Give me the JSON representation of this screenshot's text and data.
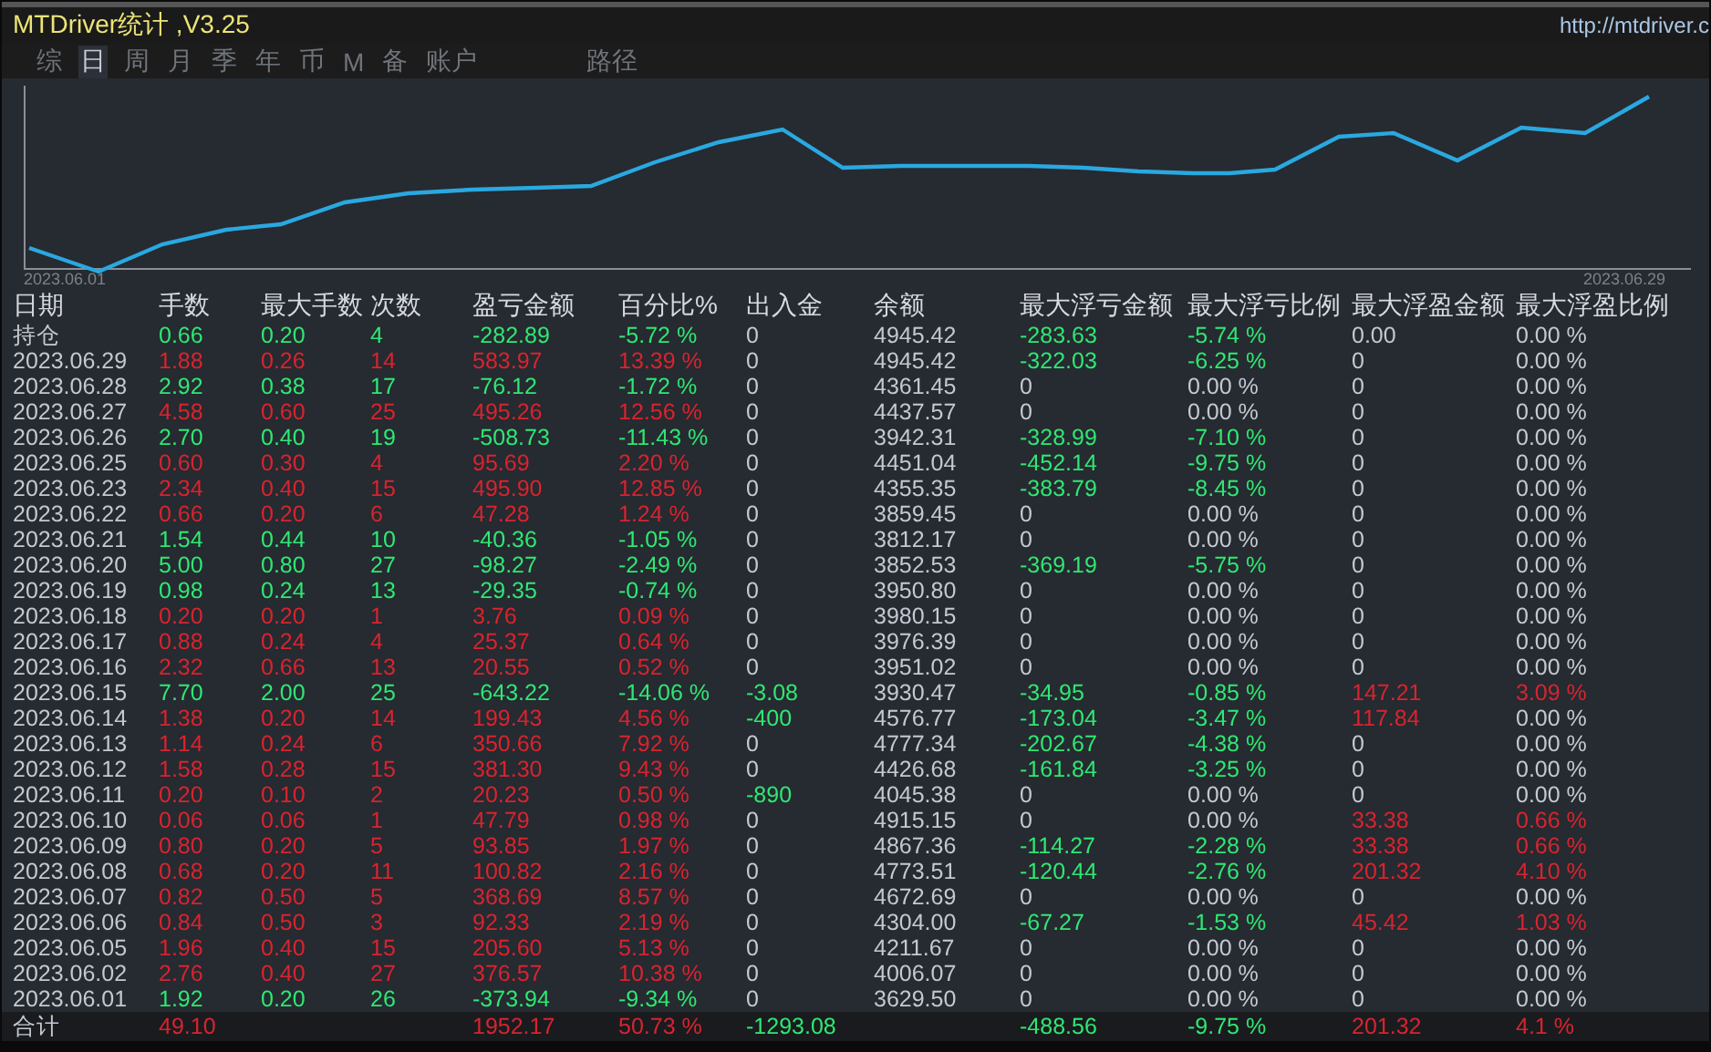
{
  "window": {
    "title": "MTDriver统计 ,V3.25",
    "url": "http://mtdriver.c"
  },
  "tabs": [
    {
      "label": "综",
      "selected": false
    },
    {
      "label": "日",
      "selected": true
    },
    {
      "label": "周",
      "selected": false
    },
    {
      "label": "月",
      "selected": false
    },
    {
      "label": "季",
      "selected": false
    },
    {
      "label": "年",
      "selected": false
    },
    {
      "label": "币",
      "selected": false
    },
    {
      "label": "M",
      "selected": false
    },
    {
      "label": "备",
      "selected": false
    },
    {
      "label": "账户",
      "selected": false
    },
    {
      "label": "路径",
      "selected": false
    }
  ],
  "equity_chart": {
    "start_label": "2023.06.01",
    "end_label": "2023.06.29"
  },
  "table": {
    "columns": [
      "日期",
      "手数",
      "最大手数",
      "次数",
      "盈亏金额",
      "百分比%",
      "出入金",
      "余额",
      "最大浮亏金额",
      "最大浮亏比例",
      "最大浮盈金额",
      "最大浮盈比例"
    ],
    "rows": [
      {
        "cells": [
          {
            "text": "持仓"
          },
          {
            "text": "0.66",
            "color": "#2ee872"
          },
          {
            "text": "0.20",
            "color": "#2ee872"
          },
          {
            "text": "4",
            "color": "#2ee872"
          },
          {
            "text": "-282.89",
            "color": "#2ee872"
          },
          {
            "text": "-5.72 %",
            "color": "#2ee872"
          },
          {
            "text": "0"
          },
          {
            "text": "4945.42"
          },
          {
            "text": "-283.63",
            "color": "#2ee872"
          },
          {
            "text": "-5.74 %",
            "color": "#2ee872"
          },
          {
            "text": "0.00"
          },
          {
            "text": "0.00 %"
          }
        ]
      },
      {
        "cells": [
          {
            "text": "2023.06.29"
          },
          {
            "text": "1.88",
            "color": "#d8242e"
          },
          {
            "text": "0.26",
            "color": "#d8242e"
          },
          {
            "text": "14",
            "color": "#d8242e"
          },
          {
            "text": "583.97",
            "color": "#d8242e"
          },
          {
            "text": "13.39 %",
            "color": "#d8242e"
          },
          {
            "text": "0"
          },
          {
            "text": "4945.42"
          },
          {
            "text": "-322.03",
            "color": "#2ee872"
          },
          {
            "text": "-6.25 %",
            "color": "#2ee872"
          },
          {
            "text": "0"
          },
          {
            "text": "0.00 %"
          }
        ]
      },
      {
        "cells": [
          {
            "text": "2023.06.28"
          },
          {
            "text": "2.92",
            "color": "#2ee872"
          },
          {
            "text": "0.38",
            "color": "#2ee872"
          },
          {
            "text": "17",
            "color": "#2ee872"
          },
          {
            "text": "-76.12",
            "color": "#2ee872"
          },
          {
            "text": "-1.72 %",
            "color": "#2ee872"
          },
          {
            "text": "0"
          },
          {
            "text": "4361.45"
          },
          {
            "text": "0"
          },
          {
            "text": "0.00 %"
          },
          {
            "text": "0"
          },
          {
            "text": "0.00 %"
          }
        ]
      },
      {
        "cells": [
          {
            "text": "2023.06.27"
          },
          {
            "text": "4.58",
            "color": "#d8242e"
          },
          {
            "text": "0.60",
            "color": "#d8242e"
          },
          {
            "text": "25",
            "color": "#d8242e"
          },
          {
            "text": "495.26",
            "color": "#d8242e"
          },
          {
            "text": "12.56 %",
            "color": "#d8242e"
          },
          {
            "text": "0"
          },
          {
            "text": "4437.57"
          },
          {
            "text": "0"
          },
          {
            "text": "0.00 %"
          },
          {
            "text": "0"
          },
          {
            "text": "0.00 %"
          }
        ]
      },
      {
        "cells": [
          {
            "text": "2023.06.26"
          },
          {
            "text": "2.70",
            "color": "#2ee872"
          },
          {
            "text": "0.40",
            "color": "#2ee872"
          },
          {
            "text": "19",
            "color": "#2ee872"
          },
          {
            "text": "-508.73",
            "color": "#2ee872"
          },
          {
            "text": "-11.43 %",
            "color": "#2ee872"
          },
          {
            "text": "0"
          },
          {
            "text": "3942.31"
          },
          {
            "text": "-328.99",
            "color": "#2ee872"
          },
          {
            "text": "-7.10 %",
            "color": "#2ee872"
          },
          {
            "text": "0"
          },
          {
            "text": "0.00 %"
          }
        ]
      },
      {
        "cells": [
          {
            "text": "2023.06.25"
          },
          {
            "text": "0.60",
            "color": "#d8242e"
          },
          {
            "text": "0.30",
            "color": "#d8242e"
          },
          {
            "text": "4",
            "color": "#d8242e"
          },
          {
            "text": "95.69",
            "color": "#d8242e"
          },
          {
            "text": "2.20 %",
            "color": "#d8242e"
          },
          {
            "text": "0"
          },
          {
            "text": "4451.04"
          },
          {
            "text": "-452.14",
            "color": "#2ee872"
          },
          {
            "text": "-9.75 %",
            "color": "#2ee872"
          },
          {
            "text": "0"
          },
          {
            "text": "0.00 %"
          }
        ]
      },
      {
        "cells": [
          {
            "text": "2023.06.23"
          },
          {
            "text": "2.34",
            "color": "#d8242e"
          },
          {
            "text": "0.40",
            "color": "#d8242e"
          },
          {
            "text": "15",
            "color": "#d8242e"
          },
          {
            "text": "495.90",
            "color": "#d8242e"
          },
          {
            "text": "12.85 %",
            "color": "#d8242e"
          },
          {
            "text": "0"
          },
          {
            "text": "4355.35"
          },
          {
            "text": "-383.79",
            "color": "#2ee872"
          },
          {
            "text": "-8.45 %",
            "color": "#2ee872"
          },
          {
            "text": "0"
          },
          {
            "text": "0.00 %"
          }
        ]
      },
      {
        "cells": [
          {
            "text": "2023.06.22"
          },
          {
            "text": "0.66",
            "color": "#d8242e"
          },
          {
            "text": "0.20",
            "color": "#d8242e"
          },
          {
            "text": "6",
            "color": "#d8242e"
          },
          {
            "text": "47.28",
            "color": "#d8242e"
          },
          {
            "text": "1.24 %",
            "color": "#d8242e"
          },
          {
            "text": "0"
          },
          {
            "text": "3859.45"
          },
          {
            "text": "0"
          },
          {
            "text": "0.00 %"
          },
          {
            "text": "0"
          },
          {
            "text": "0.00 %"
          }
        ]
      },
      {
        "cells": [
          {
            "text": "2023.06.21"
          },
          {
            "text": "1.54",
            "color": "#2ee872"
          },
          {
            "text": "0.44",
            "color": "#2ee872"
          },
          {
            "text": "10",
            "color": "#2ee872"
          },
          {
            "text": "-40.36",
            "color": "#2ee872"
          },
          {
            "text": "-1.05 %",
            "color": "#2ee872"
          },
          {
            "text": "0"
          },
          {
            "text": "3812.17"
          },
          {
            "text": "0"
          },
          {
            "text": "0.00 %"
          },
          {
            "text": "0"
          },
          {
            "text": "0.00 %"
          }
        ]
      },
      {
        "cells": [
          {
            "text": "2023.06.20"
          },
          {
            "text": "5.00",
            "color": "#2ee872"
          },
          {
            "text": "0.80",
            "color": "#2ee872"
          },
          {
            "text": "27",
            "color": "#2ee872"
          },
          {
            "text": "-98.27",
            "color": "#2ee872"
          },
          {
            "text": "-2.49 %",
            "color": "#2ee872"
          },
          {
            "text": "0"
          },
          {
            "text": "3852.53"
          },
          {
            "text": "-369.19",
            "color": "#2ee872"
          },
          {
            "text": "-5.75 %",
            "color": "#2ee872"
          },
          {
            "text": "0"
          },
          {
            "text": "0.00 %"
          }
        ]
      },
      {
        "cells": [
          {
            "text": "2023.06.19"
          },
          {
            "text": "0.98",
            "color": "#2ee872"
          },
          {
            "text": "0.24",
            "color": "#2ee872"
          },
          {
            "text": "13",
            "color": "#2ee872"
          },
          {
            "text": "-29.35",
            "color": "#2ee872"
          },
          {
            "text": "-0.74 %",
            "color": "#2ee872"
          },
          {
            "text": "0"
          },
          {
            "text": "3950.80"
          },
          {
            "text": "0"
          },
          {
            "text": "0.00 %"
          },
          {
            "text": "0"
          },
          {
            "text": "0.00 %"
          }
        ]
      },
      {
        "cells": [
          {
            "text": "2023.06.18"
          },
          {
            "text": "0.20",
            "color": "#d8242e"
          },
          {
            "text": "0.20",
            "color": "#d8242e"
          },
          {
            "text": "1",
            "color": "#d8242e"
          },
          {
            "text": "3.76",
            "color": "#d8242e"
          },
          {
            "text": "0.09 %",
            "color": "#d8242e"
          },
          {
            "text": "0"
          },
          {
            "text": "3980.15"
          },
          {
            "text": "0"
          },
          {
            "text": "0.00 %"
          },
          {
            "text": "0"
          },
          {
            "text": "0.00 %"
          }
        ]
      },
      {
        "cells": [
          {
            "text": "2023.06.17"
          },
          {
            "text": "0.88",
            "color": "#d8242e"
          },
          {
            "text": "0.24",
            "color": "#d8242e"
          },
          {
            "text": "4",
            "color": "#d8242e"
          },
          {
            "text": "25.37",
            "color": "#d8242e"
          },
          {
            "text": "0.64 %",
            "color": "#d8242e"
          },
          {
            "text": "0"
          },
          {
            "text": "3976.39"
          },
          {
            "text": "0"
          },
          {
            "text": "0.00 %"
          },
          {
            "text": "0"
          },
          {
            "text": "0.00 %"
          }
        ]
      },
      {
        "cells": [
          {
            "text": "2023.06.16"
          },
          {
            "text": "2.32",
            "color": "#d8242e"
          },
          {
            "text": "0.66",
            "color": "#d8242e"
          },
          {
            "text": "13",
            "color": "#d8242e"
          },
          {
            "text": "20.55",
            "color": "#d8242e"
          },
          {
            "text": "0.52 %",
            "color": "#d8242e"
          },
          {
            "text": "0"
          },
          {
            "text": "3951.02"
          },
          {
            "text": "0"
          },
          {
            "text": "0.00 %"
          },
          {
            "text": "0"
          },
          {
            "text": "0.00 %"
          }
        ]
      },
      {
        "cells": [
          {
            "text": "2023.06.15"
          },
          {
            "text": "7.70",
            "color": "#2ee872"
          },
          {
            "text": "2.00",
            "color": "#2ee872"
          },
          {
            "text": "25",
            "color": "#2ee872"
          },
          {
            "text": "-643.22",
            "color": "#2ee872"
          },
          {
            "text": "-14.06 %",
            "color": "#2ee872"
          },
          {
            "text": "-3.08",
            "color": "#2ee872"
          },
          {
            "text": "3930.47"
          },
          {
            "text": "-34.95",
            "color": "#2ee872"
          },
          {
            "text": "-0.85 %",
            "color": "#2ee872"
          },
          {
            "text": "147.21",
            "color": "#d8242e"
          },
          {
            "text": "3.09 %",
            "color": "#d8242e"
          }
        ]
      },
      {
        "cells": [
          {
            "text": "2023.06.14"
          },
          {
            "text": "1.38",
            "color": "#d8242e"
          },
          {
            "text": "0.20",
            "color": "#d8242e"
          },
          {
            "text": "14",
            "color": "#d8242e"
          },
          {
            "text": "199.43",
            "color": "#d8242e"
          },
          {
            "text": "4.56 %",
            "color": "#d8242e"
          },
          {
            "text": "-400",
            "color": "#2ee872"
          },
          {
            "text": "4576.77"
          },
          {
            "text": "-173.04",
            "color": "#2ee872"
          },
          {
            "text": "-3.47 %",
            "color": "#2ee872"
          },
          {
            "text": "117.84",
            "color": "#d8242e"
          },
          {
            "text": "0.00 %"
          }
        ]
      },
      {
        "cells": [
          {
            "text": "2023.06.13"
          },
          {
            "text": "1.14",
            "color": "#d8242e"
          },
          {
            "text": "0.24",
            "color": "#d8242e"
          },
          {
            "text": "6",
            "color": "#d8242e"
          },
          {
            "text": "350.66",
            "color": "#d8242e"
          },
          {
            "text": "7.92 %",
            "color": "#d8242e"
          },
          {
            "text": "0"
          },
          {
            "text": "4777.34"
          },
          {
            "text": "-202.67",
            "color": "#2ee872"
          },
          {
            "text": "-4.38 %",
            "color": "#2ee872"
          },
          {
            "text": "0"
          },
          {
            "text": "0.00 %"
          }
        ]
      },
      {
        "cells": [
          {
            "text": "2023.06.12"
          },
          {
            "text": "1.58",
            "color": "#d8242e"
          },
          {
            "text": "0.28",
            "color": "#d8242e"
          },
          {
            "text": "15",
            "color": "#d8242e"
          },
          {
            "text": "381.30",
            "color": "#d8242e"
          },
          {
            "text": "9.43 %",
            "color": "#d8242e"
          },
          {
            "text": "0"
          },
          {
            "text": "4426.68"
          },
          {
            "text": "-161.84",
            "color": "#2ee872"
          },
          {
            "text": "-3.25 %",
            "color": "#2ee872"
          },
          {
            "text": "0"
          },
          {
            "text": "0.00 %"
          }
        ]
      },
      {
        "cells": [
          {
            "text": "2023.06.11"
          },
          {
            "text": "0.20",
            "color": "#d8242e"
          },
          {
            "text": "0.10",
            "color": "#d8242e"
          },
          {
            "text": "2",
            "color": "#d8242e"
          },
          {
            "text": "20.23",
            "color": "#d8242e"
          },
          {
            "text": "0.50 %",
            "color": "#d8242e"
          },
          {
            "text": "-890",
            "color": "#2ee872"
          },
          {
            "text": "4045.38"
          },
          {
            "text": "0"
          },
          {
            "text": "0.00 %"
          },
          {
            "text": "0"
          },
          {
            "text": "0.00 %"
          }
        ]
      },
      {
        "cells": [
          {
            "text": "2023.06.10"
          },
          {
            "text": "0.06",
            "color": "#d8242e"
          },
          {
            "text": "0.06",
            "color": "#d8242e"
          },
          {
            "text": "1",
            "color": "#d8242e"
          },
          {
            "text": "47.79",
            "color": "#d8242e"
          },
          {
            "text": "0.98 %",
            "color": "#d8242e"
          },
          {
            "text": "0"
          },
          {
            "text": "4915.15"
          },
          {
            "text": "0"
          },
          {
            "text": "0.00 %"
          },
          {
            "text": "33.38",
            "color": "#d8242e"
          },
          {
            "text": "0.66 %",
            "color": "#d8242e"
          }
        ]
      },
      {
        "cells": [
          {
            "text": "2023.06.09"
          },
          {
            "text": "0.80",
            "color": "#d8242e"
          },
          {
            "text": "0.20",
            "color": "#d8242e"
          },
          {
            "text": "5",
            "color": "#d8242e"
          },
          {
            "text": "93.85",
            "color": "#d8242e"
          },
          {
            "text": "1.97 %",
            "color": "#d8242e"
          },
          {
            "text": "0"
          },
          {
            "text": "4867.36"
          },
          {
            "text": "-114.27",
            "color": "#2ee872"
          },
          {
            "text": "-2.28 %",
            "color": "#2ee872"
          },
          {
            "text": "33.38",
            "color": "#d8242e"
          },
          {
            "text": "0.66 %",
            "color": "#d8242e"
          }
        ]
      },
      {
        "cells": [
          {
            "text": "2023.06.08"
          },
          {
            "text": "0.68",
            "color": "#d8242e"
          },
          {
            "text": "0.20",
            "color": "#d8242e"
          },
          {
            "text": "11",
            "color": "#d8242e"
          },
          {
            "text": "100.82",
            "color": "#d8242e"
          },
          {
            "text": "2.16 %",
            "color": "#d8242e"
          },
          {
            "text": "0"
          },
          {
            "text": "4773.51"
          },
          {
            "text": "-120.44",
            "color": "#2ee872"
          },
          {
            "text": "-2.76 %",
            "color": "#2ee872"
          },
          {
            "text": "201.32",
            "color": "#d8242e"
          },
          {
            "text": "4.10 %",
            "color": "#d8242e"
          }
        ]
      },
      {
        "cells": [
          {
            "text": "2023.06.07"
          },
          {
            "text": "0.82",
            "color": "#d8242e"
          },
          {
            "text": "0.50",
            "color": "#d8242e"
          },
          {
            "text": "5",
            "color": "#d8242e"
          },
          {
            "text": "368.69",
            "color": "#d8242e"
          },
          {
            "text": "8.57 %",
            "color": "#d8242e"
          },
          {
            "text": "0"
          },
          {
            "text": "4672.69"
          },
          {
            "text": "0"
          },
          {
            "text": "0.00 %"
          },
          {
            "text": "0"
          },
          {
            "text": "0.00 %"
          }
        ]
      },
      {
        "cells": [
          {
            "text": "2023.06.06"
          },
          {
            "text": "0.84",
            "color": "#d8242e"
          },
          {
            "text": "0.50",
            "color": "#d8242e"
          },
          {
            "text": "3",
            "color": "#d8242e"
          },
          {
            "text": "92.33",
            "color": "#d8242e"
          },
          {
            "text": "2.19 %",
            "color": "#d8242e"
          },
          {
            "text": "0"
          },
          {
            "text": "4304.00"
          },
          {
            "text": "-67.27",
            "color": "#2ee872"
          },
          {
            "text": "-1.53 %",
            "color": "#2ee872"
          },
          {
            "text": "45.42",
            "color": "#d8242e"
          },
          {
            "text": "1.03 %",
            "color": "#d8242e"
          }
        ]
      },
      {
        "cells": [
          {
            "text": "2023.06.05"
          },
          {
            "text": "1.96",
            "color": "#d8242e"
          },
          {
            "text": "0.40",
            "color": "#d8242e"
          },
          {
            "text": "15",
            "color": "#d8242e"
          },
          {
            "text": "205.60",
            "color": "#d8242e"
          },
          {
            "text": "5.13 %",
            "color": "#d8242e"
          },
          {
            "text": "0"
          },
          {
            "text": "4211.67"
          },
          {
            "text": "0"
          },
          {
            "text": "0.00 %"
          },
          {
            "text": "0"
          },
          {
            "text": "0.00 %"
          }
        ]
      },
      {
        "cells": [
          {
            "text": "2023.06.02"
          },
          {
            "text": "2.76",
            "color": "#d8242e"
          },
          {
            "text": "0.40",
            "color": "#d8242e"
          },
          {
            "text": "27",
            "color": "#d8242e"
          },
          {
            "text": "376.57",
            "color": "#d8242e"
          },
          {
            "text": "10.38 %",
            "color": "#d8242e"
          },
          {
            "text": "0"
          },
          {
            "text": "4006.07"
          },
          {
            "text": "0"
          },
          {
            "text": "0.00 %"
          },
          {
            "text": "0"
          },
          {
            "text": "0.00 %"
          }
        ]
      },
      {
        "cells": [
          {
            "text": "2023.06.01"
          },
          {
            "text": "1.92",
            "color": "#2ee872"
          },
          {
            "text": "0.20",
            "color": "#2ee872"
          },
          {
            "text": "26",
            "color": "#2ee872"
          },
          {
            "text": "-373.94",
            "color": "#2ee872"
          },
          {
            "text": "-9.34 %",
            "color": "#2ee872"
          },
          {
            "text": "0"
          },
          {
            "text": "3629.50"
          },
          {
            "text": "0"
          },
          {
            "text": "0.00 %"
          },
          {
            "text": "0"
          },
          {
            "text": "0.00 %"
          }
        ]
      },
      {
        "cells": [
          {
            "text": "合计"
          },
          {
            "text": "49.10",
            "color": "#d8242e"
          },
          {
            "text": ""
          },
          {
            "text": ""
          },
          {
            "text": "1952.17",
            "color": "#d8242e"
          },
          {
            "text": "50.73 %",
            "color": "#d8242e"
          },
          {
            "text": "-1293.08",
            "color": "#2ee872"
          },
          {
            "text": ""
          },
          {
            "text": "-488.56",
            "color": "#2ee872"
          },
          {
            "text": "-9.75 %",
            "color": "#2ee872"
          },
          {
            "text": "201.32",
            "color": "#d8242e"
          },
          {
            "text": "4.1 %",
            "color": "#d8242e"
          }
        ]
      }
    ]
  }
}
